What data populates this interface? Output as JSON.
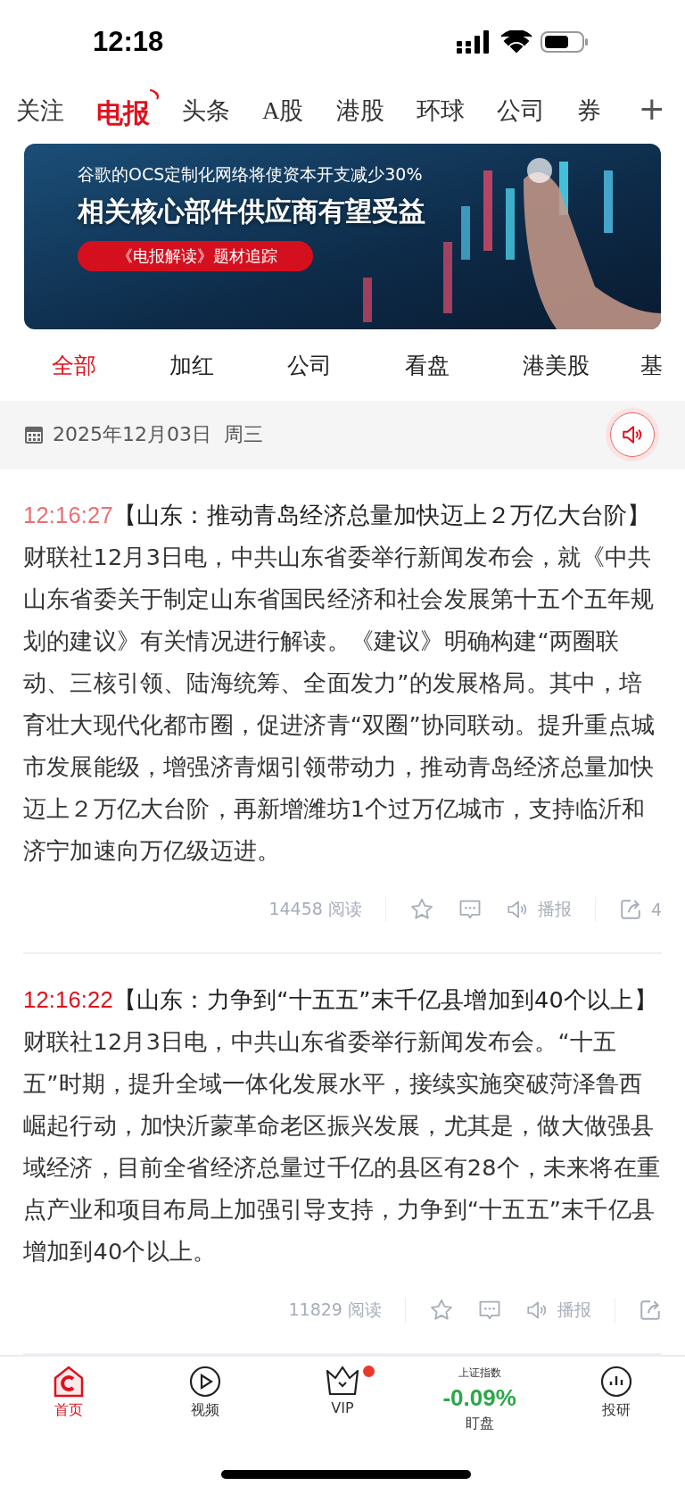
{
  "status_bar": {
    "time": "12:18"
  },
  "channel_tabs": [
    {
      "label": "关注",
      "selected": false
    },
    {
      "label": "电报",
      "selected": true
    },
    {
      "label": "头条",
      "selected": false
    },
    {
      "label": "A股",
      "selected": false
    },
    {
      "label": "港股",
      "selected": false
    },
    {
      "label": "环球",
      "selected": false
    },
    {
      "label": "公司",
      "selected": false
    },
    {
      "label": "券",
      "selected": false
    }
  ],
  "add_channel": "+",
  "banner": {
    "subtitle": "谷歌的OCS定制化网络将使资本开支减少30%",
    "title": "相关核心部件供应商有望受益",
    "tag": "《电报解读》题材追踪"
  },
  "filter_tabs": [
    {
      "label": "全部",
      "selected": true
    },
    {
      "label": "加红",
      "selected": false
    },
    {
      "label": "公司",
      "selected": false
    },
    {
      "label": "看盘",
      "selected": false
    },
    {
      "label": "港美股",
      "selected": false
    },
    {
      "label": "基",
      "selected": false
    }
  ],
  "date_bar": {
    "date": "2025年12月03日",
    "weekday": "周三"
  },
  "articles": [
    {
      "time": "12:16:27",
      "read": true,
      "title": "【山东：推动青岛经济总量加快迈上２万亿大台阶】",
      "body": "财联社12月3日电，中共山东省委举行新闻发布会，就《中共山东省委关于制定山东省国民经济和社会发展第十五个五年规划的建议》有关情况进行解读。《建议》明确构建“两圈联动、三核引领、陆海统筹、全面发力”的发展格局。其中，培育壮大现代化都市圈，促进济青“双圈”协同联动。提升重点城市发展能级，增强济青烟引领带动力，推动青岛经济总量加快迈上２万亿大台阶，再新增潍坊1个过万亿城市，支持临沂和济宁加速向万亿级迈进。",
      "reads": "14458",
      "read_label": "阅读",
      "broadcast": "播报",
      "shares": "4"
    },
    {
      "time": "12:16:22",
      "read": false,
      "title": "【山东：力争到“十五五”末千亿县增加到40个以上】",
      "body": "财联社12月3日电，中共山东省委举行新闻发布会。“十五五”时期，提升全域一体化发展水平，接续实施突破菏泽鲁西崛起行动，加快沂蒙革命老区振兴发展，尤其是，做大做强县域经济，目前全省经济总量过千亿的县区有28个，未来将在重点产业和项目布局上加强引导支持，力争到“十五五”末千亿县增加到40个以上。",
      "reads": "11829",
      "read_label": "阅读",
      "broadcast": "播报"
    }
  ],
  "bottom_nav": [
    {
      "kind": "home",
      "label": "首页",
      "selected": true
    },
    {
      "kind": "video",
      "label": "视频",
      "selected": false
    },
    {
      "kind": "vip",
      "label": "VIP",
      "selected": false,
      "badge": true
    },
    {
      "kind": "index",
      "label": "盯盘",
      "selected": false,
      "index_name": "上证指数",
      "index_value": "-0.09%"
    },
    {
      "kind": "research",
      "label": "投研",
      "selected": false
    }
  ]
}
